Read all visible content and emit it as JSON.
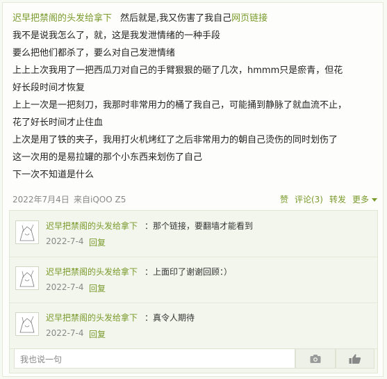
{
  "post": {
    "author": "迟早把禁阁的头发给拿下",
    "intro": "然后就是,我又伤害了我自己",
    "link_label": "网页链接",
    "lines": [
      "我不是说我怎么了，就，这是我发泄情绪的一种手段",
      "要么把他们都杀了，要么对自己发泄情绪",
      "上上上次我用了一把西瓜刀对自己的手臂狠狠的砸了几次，hmmm只是瘀青，但花",
      "好长段时间才恢复",
      "上上一次是一把刻刀，我那时非常用力的桶了我自己，可能捅到静脉了就血流不止，",
      "花了好长时间才止住血",
      "上次是用了铁的夹子，我用打火机烤红了之后非常用力的朝自己烫伤的同时划伤了",
      "这一次用的是易拉罐的那个小东西来划伤了自己",
      "下一次不知道是什么"
    ],
    "date": "2022年7月4日",
    "source": "来自iQOO Z5",
    "actions": {
      "like": "赞",
      "comment": "评论(3)",
      "repost": "转发",
      "more": "更多"
    }
  },
  "comments": [
    {
      "user": "迟早把禁阁的头发给拿下",
      "text": "：那个链接，要翻墙才能看到",
      "date": "2022-7-4",
      "reply": "回复"
    },
    {
      "user": "迟早把禁阁的头发给拿下",
      "text": "：上面印了谢谢回顾：）",
      "date": "2022-7-4",
      "reply": "回复"
    },
    {
      "user": "迟早把禁阁的头发给拿下",
      "text": "：真令人期待",
      "date": "2022-7-4",
      "reply": "回复"
    }
  ],
  "reply_box": {
    "placeholder": "我也说一句"
  },
  "icons": {
    "camera": "camera-icon",
    "like": "thumbs-up-icon",
    "avatar": "avatar-drawing"
  },
  "colors": {
    "link": "#7a9a2c",
    "background": "#f7f9f3"
  }
}
